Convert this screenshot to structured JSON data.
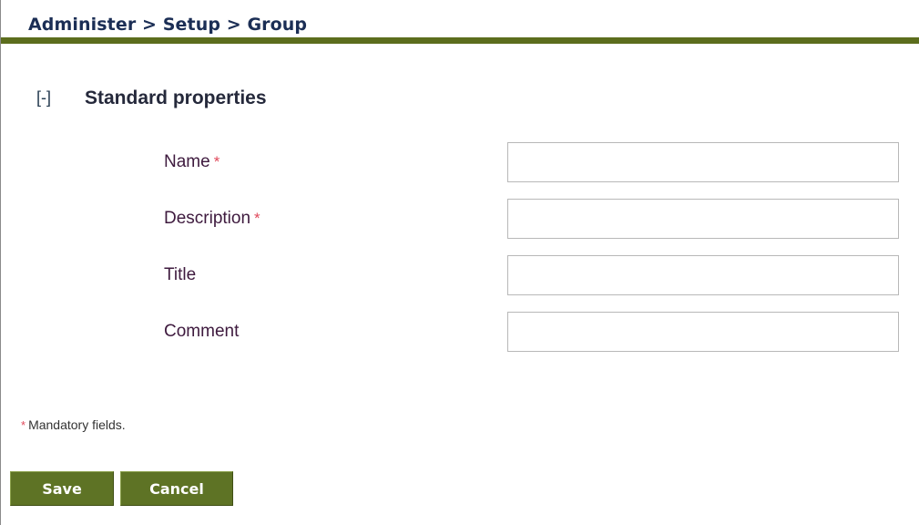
{
  "header": {
    "breadcrumb": "Administer > Setup > Group"
  },
  "section": {
    "toggle": "[-]",
    "title": "Standard properties"
  },
  "fields": [
    {
      "label": "Name",
      "required_marker": "*",
      "value": ""
    },
    {
      "label": "Description",
      "required_marker": "*",
      "value": ""
    },
    {
      "label": "Title",
      "required_marker": "",
      "value": ""
    },
    {
      "label": "Comment",
      "required_marker": "",
      "value": ""
    }
  ],
  "footer": {
    "mandatory_marker": "*",
    "mandatory_text": "Mandatory fields."
  },
  "buttons": {
    "save": "Save",
    "cancel": "Cancel"
  },
  "colors": {
    "accent_bar": "#5c6d1d",
    "button_bg": "#5e7325",
    "required_marker": "#e04a5c"
  }
}
